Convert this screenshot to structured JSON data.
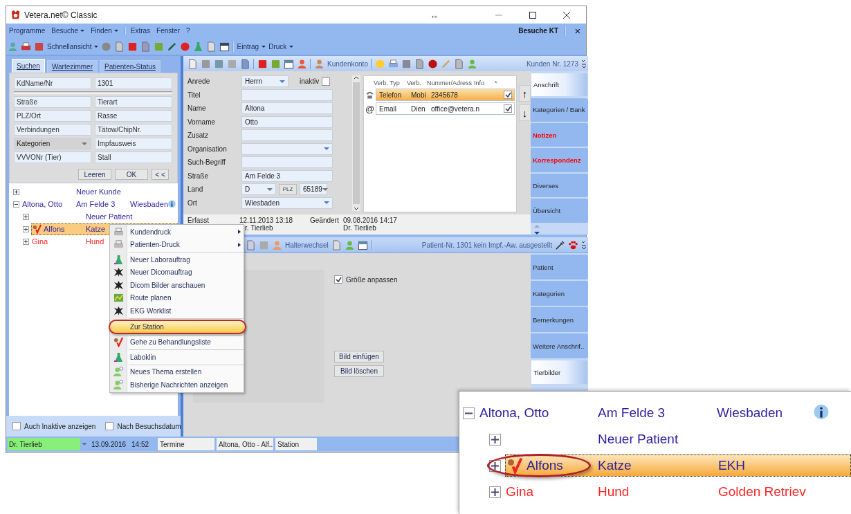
{
  "window": {
    "title": "Vetera.net© Classic",
    "resize_hint": "↔"
  },
  "menu": [
    {
      "label": "Programme",
      "dropdown": false,
      "separator_before": false
    },
    {
      "label": "Besuche",
      "dropdown": true,
      "separator_before": false
    },
    {
      "label": "Finden",
      "dropdown": true,
      "separator_before": false
    },
    {
      "label": "Extras",
      "dropdown": false,
      "separator_before": true
    },
    {
      "label": "Fenster",
      "dropdown": false,
      "separator_before": false
    },
    {
      "label": "?",
      "dropdown": false,
      "separator_before": false
    }
  ],
  "menu_right": {
    "title": "Besuche KT",
    "close": "×"
  },
  "toolbar": {
    "quick_view": "Schnellansicht",
    "entry": "Eintrag",
    "print": "Druck"
  },
  "left_tabs": [
    {
      "label": "Suchen",
      "selected": true
    },
    {
      "label": "Wartezimmer",
      "selected": false
    },
    {
      "label": "Patienten-Status",
      "selected": false
    }
  ],
  "search": {
    "rows": [
      [
        {
          "kind": "field",
          "placeholder": "KdName/Nr"
        },
        {
          "kind": "field",
          "value": "1301"
        }
      ],
      [
        {
          "kind": "field",
          "placeholder": "Straße"
        },
        {
          "kind": "field",
          "placeholder": "Tierart"
        }
      ],
      [
        {
          "kind": "field",
          "placeholder": "PLZ/Ort"
        },
        {
          "kind": "field",
          "placeholder": "Rasse"
        }
      ],
      [
        {
          "kind": "field",
          "placeholder": "Verbindungen"
        },
        {
          "kind": "field",
          "placeholder": "Tätow/ChipNr."
        }
      ],
      [
        {
          "kind": "dropdown",
          "placeholder": "Kategorien"
        },
        {
          "kind": "field",
          "placeholder": "Impfausweis"
        }
      ],
      [
        {
          "kind": "field",
          "placeholder": "VVVONr (Tier)"
        },
        {
          "kind": "field",
          "placeholder": "Stall"
        }
      ]
    ],
    "buttons": [
      "Leeren",
      "OK",
      "< <"
    ]
  },
  "tree": [
    {
      "cols": [
        "Neuer Kunde"
      ],
      "expanded": false,
      "selected": false,
      "color": "#2b1fa0"
    },
    {
      "name": "Altona, Otto",
      "cols": [
        "Am Felde 3",
        "Wiesbaden"
      ],
      "expanded": true,
      "selected": false,
      "info": true,
      "color": "#2b1fa0",
      "children": [
        {
          "cols": [
            "Neuer Patient"
          ],
          "expanded": false,
          "selected": false,
          "color": "#2b1fa0"
        },
        {
          "name": "Alfons",
          "cols": [
            "Katze"
          ],
          "expanded": false,
          "selected": true,
          "treatment": true,
          "color": "#2b1fa0"
        },
        {
          "name": "Gina",
          "cols": [
            "Hund"
          ],
          "expanded": false,
          "selected": false,
          "color": "#ff2626"
        }
      ]
    }
  ],
  "filters": [
    {
      "label": "Auch Inaktive anzeigen",
      "checked": false
    },
    {
      "label": "Nach Besuchsdatum",
      "checked": false
    }
  ],
  "customer_toolbar": {
    "account": "Kundenkonto",
    "number": "Kunden Nr. 1273"
  },
  "form": [
    {
      "label": "Anrede",
      "kind": "dropdown",
      "value": "Herrn",
      "checkbox": {
        "label": "inaktiv",
        "checked": false
      }
    },
    {
      "label": "Titel",
      "kind": "text"
    },
    {
      "label": "Name",
      "kind": "text",
      "value": "Altona"
    },
    {
      "label": "Vorname",
      "kind": "text",
      "value": "Otto"
    },
    {
      "label": "Zusatz",
      "kind": "text"
    },
    {
      "label": "Organisation",
      "kind": "dropdown"
    },
    {
      "label": "Such-Begriff",
      "kind": "text"
    },
    {
      "label": "Straße",
      "kind": "text",
      "value": "Am Felde 3"
    },
    {
      "label": "Land",
      "kind": "land",
      "value": "D",
      "button": "PLZ",
      "zip": "65189"
    },
    {
      "label": "Ort",
      "kind": "dropdown",
      "value": "Wiesbaden"
    }
  ],
  "contacts": {
    "columns": [
      "Verb. Typ",
      "Verb.",
      "Nummer/Adress",
      "Info",
      "*"
    ],
    "rows": [
      {
        "kind": "phone",
        "cells": [
          "Telefon",
          "Mobi",
          "2345678"
        ],
        "checked": true,
        "selected": true
      },
      {
        "kind": "email",
        "symbol": "@",
        "cells": [
          "Email",
          "Dien",
          "office@vetera.n"
        ],
        "checked": true,
        "selected": false
      }
    ],
    "move_up": "↑",
    "move_down": "↓"
  },
  "record": {
    "created_label": "Erfasst",
    "created": "12.11.2013 13:18",
    "created_by": "r. Tierlieb",
    "changed_label": "Geändert",
    "changed": "09.08.2016 14:17",
    "changed_by": "Dr. Tierlieb"
  },
  "customer_tabs": [
    {
      "label": "Anschrift",
      "selected": true,
      "highlight": false
    },
    {
      "label": "Kategorien / Bank",
      "selected": false,
      "highlight": false
    },
    {
      "label": "Notizen",
      "selected": false,
      "highlight": true
    },
    {
      "label": "Korrespondenz",
      "selected": false,
      "highlight": true
    },
    {
      "label": "Diverses",
      "selected": false,
      "highlight": false
    },
    {
      "label": "Übersicht",
      "selected": false,
      "highlight": false
    }
  ],
  "patient_toolbar": {
    "action": "Halterwechsel",
    "status": "Patient-Nr. 1301 kein Impf.-Aw. ausgestellt"
  },
  "patient_images": {
    "fit": {
      "label": "Größe anpassen",
      "checked": true
    },
    "buttons": [
      "Bild einfügen",
      "Bild löschen"
    ]
  },
  "patient_tabs": [
    {
      "label": "Patient",
      "selected": false
    },
    {
      "label": "Kategorien",
      "selected": false
    },
    {
      "label": "Bemerkungen",
      "selected": false
    },
    {
      "label": "Weitere Anschrif..",
      "selected": false
    },
    {
      "label": "Tierbilder",
      "selected": true
    }
  ],
  "status_bar": {
    "user": "Dr. Tierlieb",
    "date": "13.09.2016",
    "time": "14:52",
    "cells": [
      "Termine",
      "Altona, Otto - Alf..",
      "Station"
    ]
  },
  "context_menu": [
    {
      "kind": "item",
      "label": "Kundendruck",
      "submenu": true,
      "selected": false
    },
    {
      "kind": "item",
      "label": "Patienten-Druck",
      "submenu": true,
      "selected": false
    },
    {
      "kind": "separator"
    },
    {
      "kind": "item",
      "label": "Neuer Laborauftrag",
      "submenu": false,
      "selected": false
    },
    {
      "kind": "item",
      "label": "Neuer Dicomauftrag",
      "submenu": false,
      "selected": false
    },
    {
      "kind": "item",
      "label": "Dicom Bilder anschauen",
      "submenu": false,
      "selected": false
    },
    {
      "kind": "item",
      "label": "Route planen",
      "submenu": false,
      "selected": false
    },
    {
      "kind": "item",
      "label": "EKG Worklist",
      "submenu": false,
      "selected": false
    },
    {
      "kind": "separator"
    },
    {
      "kind": "item",
      "label": "Zur Station",
      "submenu": false,
      "selected": true
    },
    {
      "kind": "separator"
    },
    {
      "kind": "item",
      "label": "Gehe zu Behandlungsliste",
      "submenu": false,
      "selected": false
    },
    {
      "kind": "separator"
    },
    {
      "kind": "item",
      "label": "Laboklin",
      "submenu": false,
      "selected": false
    },
    {
      "kind": "separator"
    },
    {
      "kind": "item",
      "label": "Neues Thema erstellen",
      "submenu": false,
      "selected": false
    },
    {
      "kind": "item",
      "label": "Bisherige Nachrichten anzeigen",
      "submenu": false,
      "selected": false
    }
  ],
  "callout": {
    "tree": [
      {
        "name": "Altona, Otto",
        "cols": [
          "Am Felde 3",
          "Wiesbaden"
        ],
        "expanded": true,
        "selected": false,
        "info": true,
        "color": "#2b1fa0",
        "children": [
          {
            "cols": [
              "Neuer Patient"
            ],
            "expanded": false,
            "selected": false,
            "color": "#2b1fa0"
          },
          {
            "name": "Alfons",
            "cols": [
              "Katze",
              "EKH"
            ],
            "expanded": false,
            "selected": true,
            "treatment": true,
            "color": "#2b1fa0"
          },
          {
            "name": "Gina",
            "cols": [
              "Hund",
              "Golden Retriev"
            ],
            "expanded": false,
            "selected": false,
            "color": "#ff2626"
          }
        ]
      }
    ]
  }
}
